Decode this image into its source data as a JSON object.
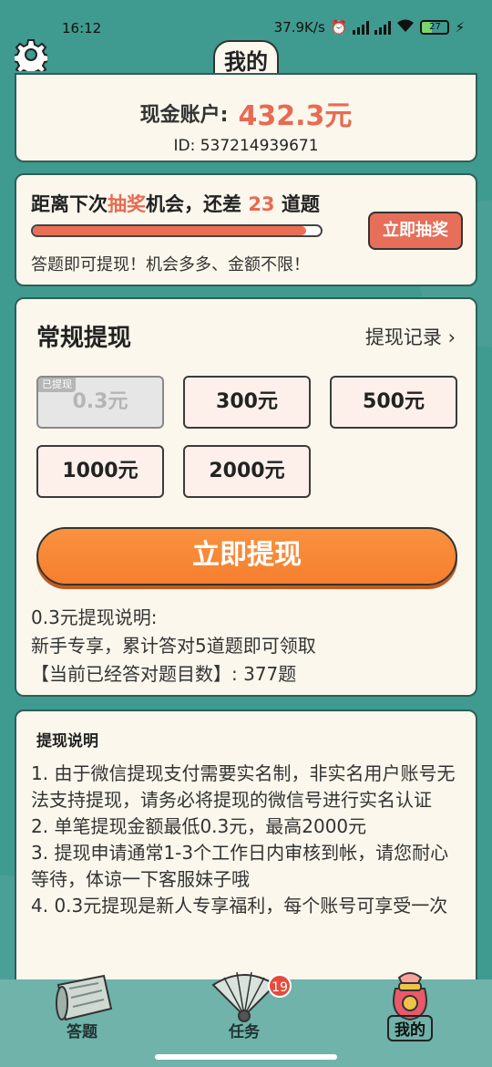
{
  "status_bar": {
    "time": "16:12",
    "net_speed": "37.9K/s",
    "battery": "27"
  },
  "header": {
    "title": "我的"
  },
  "account": {
    "label": "现金账户:",
    "value": "432.3元",
    "id_text": "ID: 537214939671"
  },
  "lottery": {
    "title_prefix": "距离下次",
    "title_highlight": "抽奖",
    "title_middle": "机会，还差 ",
    "remaining": "23",
    "title_suffix": " 道题",
    "progress_fraction": 0.95,
    "button_label": "立即抽奖",
    "description": "答题即可提现！机会多多、金额不限！"
  },
  "withdraw": {
    "title": "常规提现",
    "record_label": "提现记录",
    "amounts": [
      {
        "label": "0.3元",
        "tag": "已提现",
        "disabled": true
      },
      {
        "label": "300元"
      },
      {
        "label": "500元"
      },
      {
        "label": "1000元"
      },
      {
        "label": "2000元"
      }
    ],
    "button_label": "立即提现",
    "info_lines": [
      "0.3元提现说明:",
      "新手专享，累计答对5道题即可领取",
      "【当前已经答对题目数】: 377题"
    ]
  },
  "notes": {
    "title": "提现说明",
    "lines": [
      "1. 由于微信提现支付需要实名制，非实名用户账号无法支持提现，请务必将提现的微信号进行实名认证",
      "2. 单笔提现金额最低0.3元，最高2000元",
      "3. 提现申请通常1-3个工作日内审核到帐，请您耐心等待，体谅一下客服妹子哦",
      "4. 0.3元提现是新人专享福利，每个账号可享受一次"
    ]
  },
  "bottom_nav": {
    "items": [
      {
        "label": "答题",
        "icon": "map-scroll-icon"
      },
      {
        "label": "任务",
        "icon": "fan-icon",
        "badge": "19"
      },
      {
        "label": "我的",
        "icon": "lucky-bag-icon",
        "active": true
      }
    ]
  },
  "colors": {
    "background": "#3f9a8f",
    "card": "#fbf7ec",
    "accent": "#e96a52",
    "primary_button": "#f57f2f",
    "nav": "#6fb3aa"
  }
}
